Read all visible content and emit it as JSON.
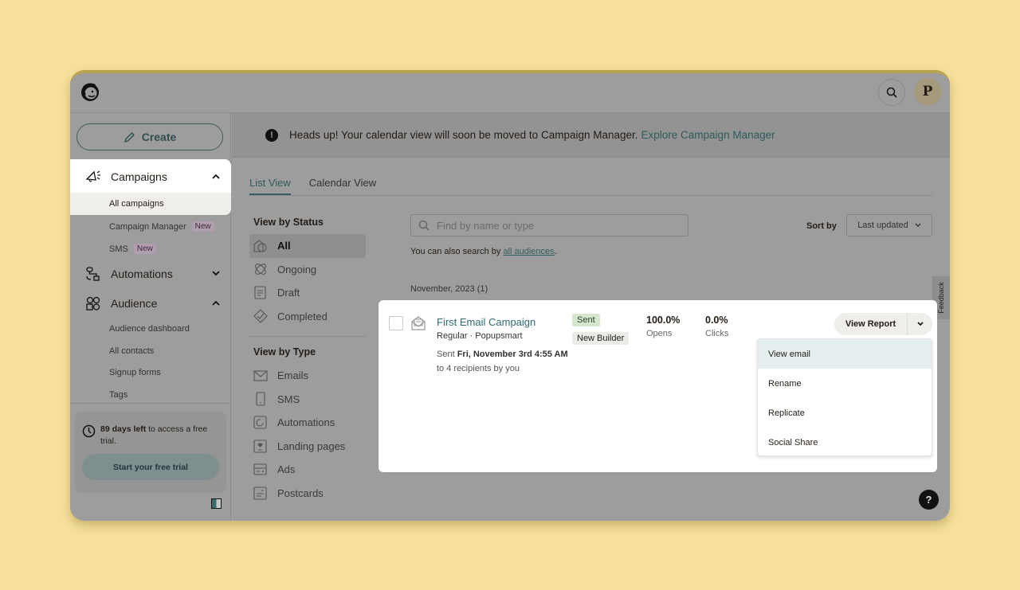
{
  "topbar": {
    "logo": "mailchimp-freddie-logo",
    "search_icon": "search-icon",
    "avatar_initial": "P"
  },
  "sidebar": {
    "create_label": "Create",
    "campaigns": {
      "label": "Campaigns",
      "expanded": true,
      "items": [
        {
          "label": "All campaigns",
          "active": true
        },
        {
          "label": "Campaign Manager",
          "badge": "New"
        },
        {
          "label": "SMS",
          "badge": "New"
        }
      ]
    },
    "automations": {
      "label": "Automations",
      "expanded": false
    },
    "audience": {
      "label": "Audience",
      "expanded": true,
      "items": [
        {
          "label": "Audience dashboard"
        },
        {
          "label": "All contacts"
        },
        {
          "label": "Signup forms"
        },
        {
          "label": "Tags"
        }
      ]
    },
    "trial": {
      "bold": "89 days left",
      "rest": " to access a free trial.",
      "button": "Start your free trial"
    }
  },
  "banner": {
    "text": "Heads up! Your calendar view will soon be moved to Campaign Manager.",
    "link": "Explore Campaign Manager"
  },
  "tabs": [
    {
      "label": "List View",
      "active": true
    },
    {
      "label": "Calendar View",
      "active": false
    }
  ],
  "filters": {
    "status_heading": "View by Status",
    "status": [
      {
        "label": "All",
        "active": true,
        "icon": "all-campaigns-icon"
      },
      {
        "label": "Ongoing",
        "icon": "ongoing-icon"
      },
      {
        "label": "Draft",
        "icon": "draft-icon"
      },
      {
        "label": "Completed",
        "icon": "completed-icon"
      }
    ],
    "type_heading": "View by Type",
    "types": [
      {
        "label": "Emails",
        "icon": "email-icon"
      },
      {
        "label": "SMS",
        "icon": "sms-icon"
      },
      {
        "label": "Automations",
        "icon": "automation-icon"
      },
      {
        "label": "Landing pages",
        "icon": "landing-page-icon"
      },
      {
        "label": "Ads",
        "icon": "ads-icon"
      },
      {
        "label": "Postcards",
        "icon": "postcard-icon"
      }
    ]
  },
  "search": {
    "placeholder": "Find by name or type",
    "value": "",
    "hint_prefix": "You can also search by ",
    "hint_link": "all audiences",
    "hint_suffix": "."
  },
  "sort": {
    "label": "Sort by",
    "selected": "Last updated"
  },
  "group_label": "November, 2023 (1)",
  "feedback_label": "Feedback",
  "campaign": {
    "title": "First Email Campaign",
    "meta": "Regular · Popupsmart",
    "sent_prefix": "Sent ",
    "sent_date": "Fri, November 3rd 4:55 AM",
    "recipients": "to 4 recipients by you",
    "status_badge": "Sent",
    "builder_badge": "New Builder",
    "opens_value": "100.0%",
    "opens_label": "Opens",
    "clicks_value": "0.0%",
    "clicks_label": "Clicks",
    "action_button": "View Report",
    "menu": [
      "View email",
      "Rename",
      "Replicate",
      "Social Share"
    ]
  },
  "help_label": "?",
  "colors": {
    "background": "#f6e09a",
    "overlay_gray": "#9d9d9d",
    "accent_teal": "#2f6a70",
    "sent_badge": "#d7e7cf",
    "new_badge": "#b19fb0"
  }
}
